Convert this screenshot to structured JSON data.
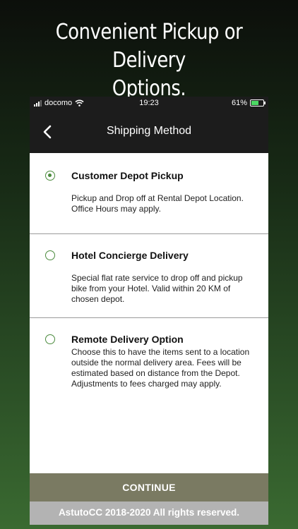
{
  "headline": {
    "line1": "Convenient Pickup or Delivery",
    "line2": "Options."
  },
  "status_bar": {
    "carrier": "docomo",
    "time": "19:23",
    "battery_text": "61%",
    "battery_level": 0.61,
    "signal_bars_active": 3
  },
  "nav": {
    "title": "Shipping Method",
    "back_icon": "chevron-left-icon"
  },
  "options": [
    {
      "title": "Customer Depot Pickup",
      "description": "Pickup and Drop off at Rental Depot Location. Office Hours may apply.",
      "selected": true
    },
    {
      "title": "Hotel Concierge Delivery",
      "description": "Special flat rate service to drop off and pickup bike from your Hotel. Valid within 20 KM of chosen depot.",
      "selected": false
    },
    {
      "title": "Remote Delivery Option",
      "description": "Choose this to have the items sent to a location outside the normal delivery area. Fees will be estimated based on distance from the Depot. Adjustments to fees charged may apply.",
      "selected": false
    }
  ],
  "continue_label": "CONTINUE",
  "footer_text": "AstutoCC 2018-2020 All rights reserved.",
  "colors": {
    "accent_green": "#4a8a3c",
    "button": "#7a7a62",
    "footer": "#b3b3b3",
    "nav_bar": "#1c1c1c"
  }
}
